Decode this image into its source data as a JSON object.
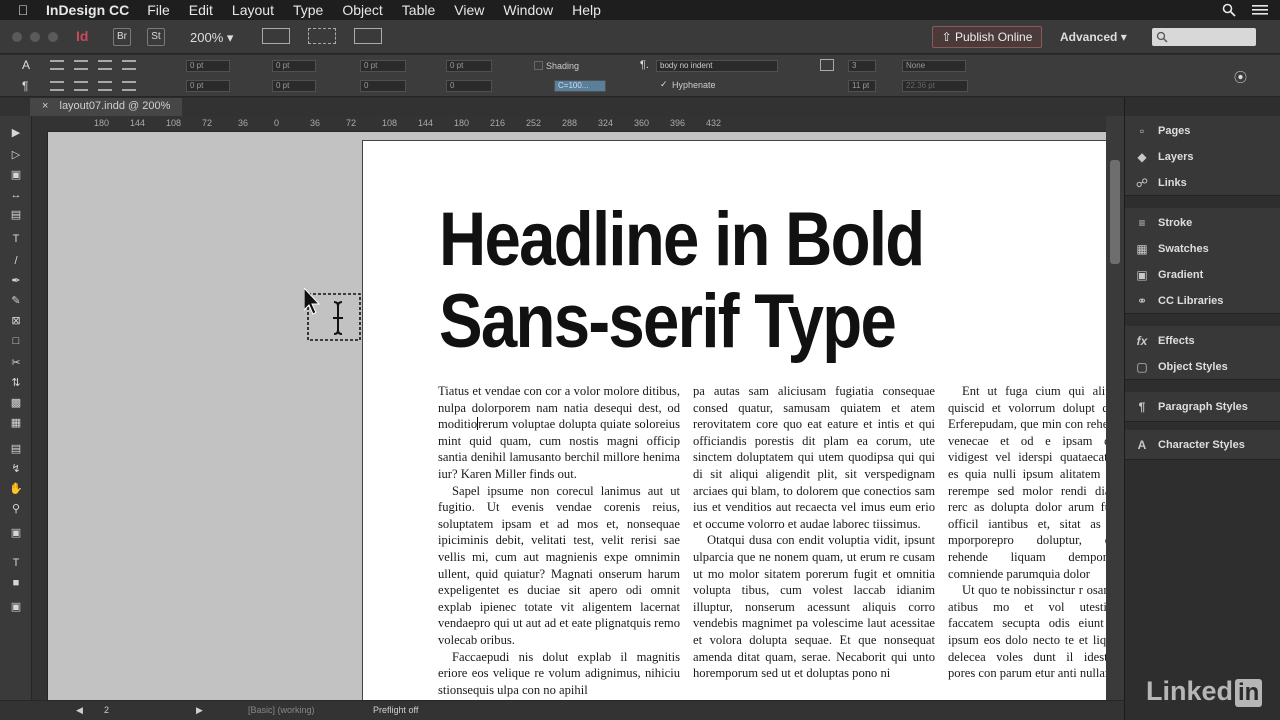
{
  "menubar": {
    "app_name": "InDesign CC",
    "items": [
      "File",
      "Edit",
      "Layout",
      "Type",
      "Object",
      "Table",
      "View",
      "Window",
      "Help"
    ]
  },
  "appbar": {
    "bridge_label": "Br",
    "stock_label": "St",
    "zoom": "200%",
    "publish_label": "Publish Online",
    "workspace": "Advanced"
  },
  "control": {
    "indent_values": [
      "0 pt",
      "0 pt",
      "0 pt",
      "0 pt"
    ],
    "space_values": [
      "0 pt",
      "0 pt",
      "0",
      "0"
    ],
    "shading_label": "Shading",
    "shading_color": "C=100...",
    "paragraph_style": "body no indent",
    "hyphenate_label": "Hyphenate",
    "columns_value": "3",
    "span_value": "None",
    "gutter_value": "11 pt",
    "baseline_value": "22.36 pt"
  },
  "tab": {
    "label": "layout07.indd @ 200%"
  },
  "ruler": {
    "ticks": [
      "180",
      "144",
      "108",
      "72",
      "36",
      "0",
      "36",
      "72",
      "108",
      "144",
      "180",
      "216",
      "252",
      "288",
      "324",
      "360",
      "396",
      "432"
    ]
  },
  "page": {
    "headline_line1": "Headline in Bold",
    "headline_line2": "Sans-serif Type",
    "col1": {
      "p1a": "Tiatus et vendae con cor a volor molore ditibus, nulpa dolorporem nam natia desequi dest, od moditio",
      "p1b": "rerum voluptae dolupta quiate soloreius mint quid quam, cum nostis magni officip santia denihil lamusanto berchil millore henima iur? Karen Miller finds out.",
      "p2": "Sapel ipsume non corecul lanimus aut ut fugitio. Ut evenis vendae corenis reius, soluptatem ipsam et ad mos et, nonsequae ipiciminis debit, velitati test, velit rerisi sae vellis mi, cum aut magnienis expe omnimin ullent, quid quiatur? Magnati onserum harum expeligentet es duciae sit apero odi omnit explab ipienec totate vit aligentem lacernat vendaepro qui ut aut ad et eate plignatquis remo volecab oribus.",
      "p3": "Faccaepudi nis dolut explab il magnitis eriore eos velique re volum adignimus, nihiciu stionsequis ulpa con no apihil"
    },
    "col2": {
      "p1": "pa autas sam aliciusam fugiatia consequae consed quatur, samusam quiatem et atem rerovitatem core quo eat eature et intis et qui officiandis porestis dit plam ea corum, ute sinctem doluptatem qui utem quodipsa qui qui di sit aliqui aligendit plit, sit verspedignam arciaes qui blam, to dolorem que conectios sam ius et venditios aut recaecta vel imus eum erio et occume volorro et audae laborec tiissimus.",
      "p2": "Otatqui dusa con endit voluptia vidit, ipsunt ulparcia que ne nonem quam, ut erum re cusam ut mo molor sitatem porerum fugit et omnitia volupta tibus, cum volest laccab idianim illuptur, nonserum acessunt aliquis corro vendebis magnimet pa volescime laut acessitae et volora dolupta sequae. Et que nonsequat amenda ditat quam, serae. Necaborit qui unto horemporum sed ut et doluptas pono ni"
    },
    "col3": {
      "p1": "Ent ut fuga cium qui alit v quiscid et volorrum dolupt dus. Erferepudam, que min con rehenis venecae et od e ipsam quo vidigest vel iderspi quataecatem es quia nulli ipsum alitatem qui rerempe sed molor rendi diatat rerc as dolupta dolor arum fuga officil iantibus et, sitat as do mporporepro doluptur, con rehende liquam demporibu comniende parumquia dolor",
      "p2": "Ut quo te nobissinctur r osantot atibus mo et vol utestium faccatem secupta odis eiunt as ipsum eos dolo necto te et liquas delecea voles dunt il idestem pores con parum etur anti nullant"
    }
  },
  "statusbar": {
    "page_number": "2",
    "profile": "[Basic] (working)",
    "preflight": "Preflight off"
  },
  "panels": {
    "group1": [
      "Pages",
      "Layers",
      "Links"
    ],
    "group2": [
      "Stroke",
      "Swatches",
      "Gradient",
      "CC Libraries"
    ],
    "group3": [
      "Effects",
      "Object Styles"
    ],
    "group4": [
      "Paragraph Styles"
    ],
    "group5": [
      "Character Styles"
    ]
  },
  "watermark": {
    "text": "Linked",
    "badge": "in"
  },
  "colors": {
    "accent_publish": "#8a5a5a",
    "paper": "#ffffff",
    "pasteboard": "#c2c2c2"
  }
}
